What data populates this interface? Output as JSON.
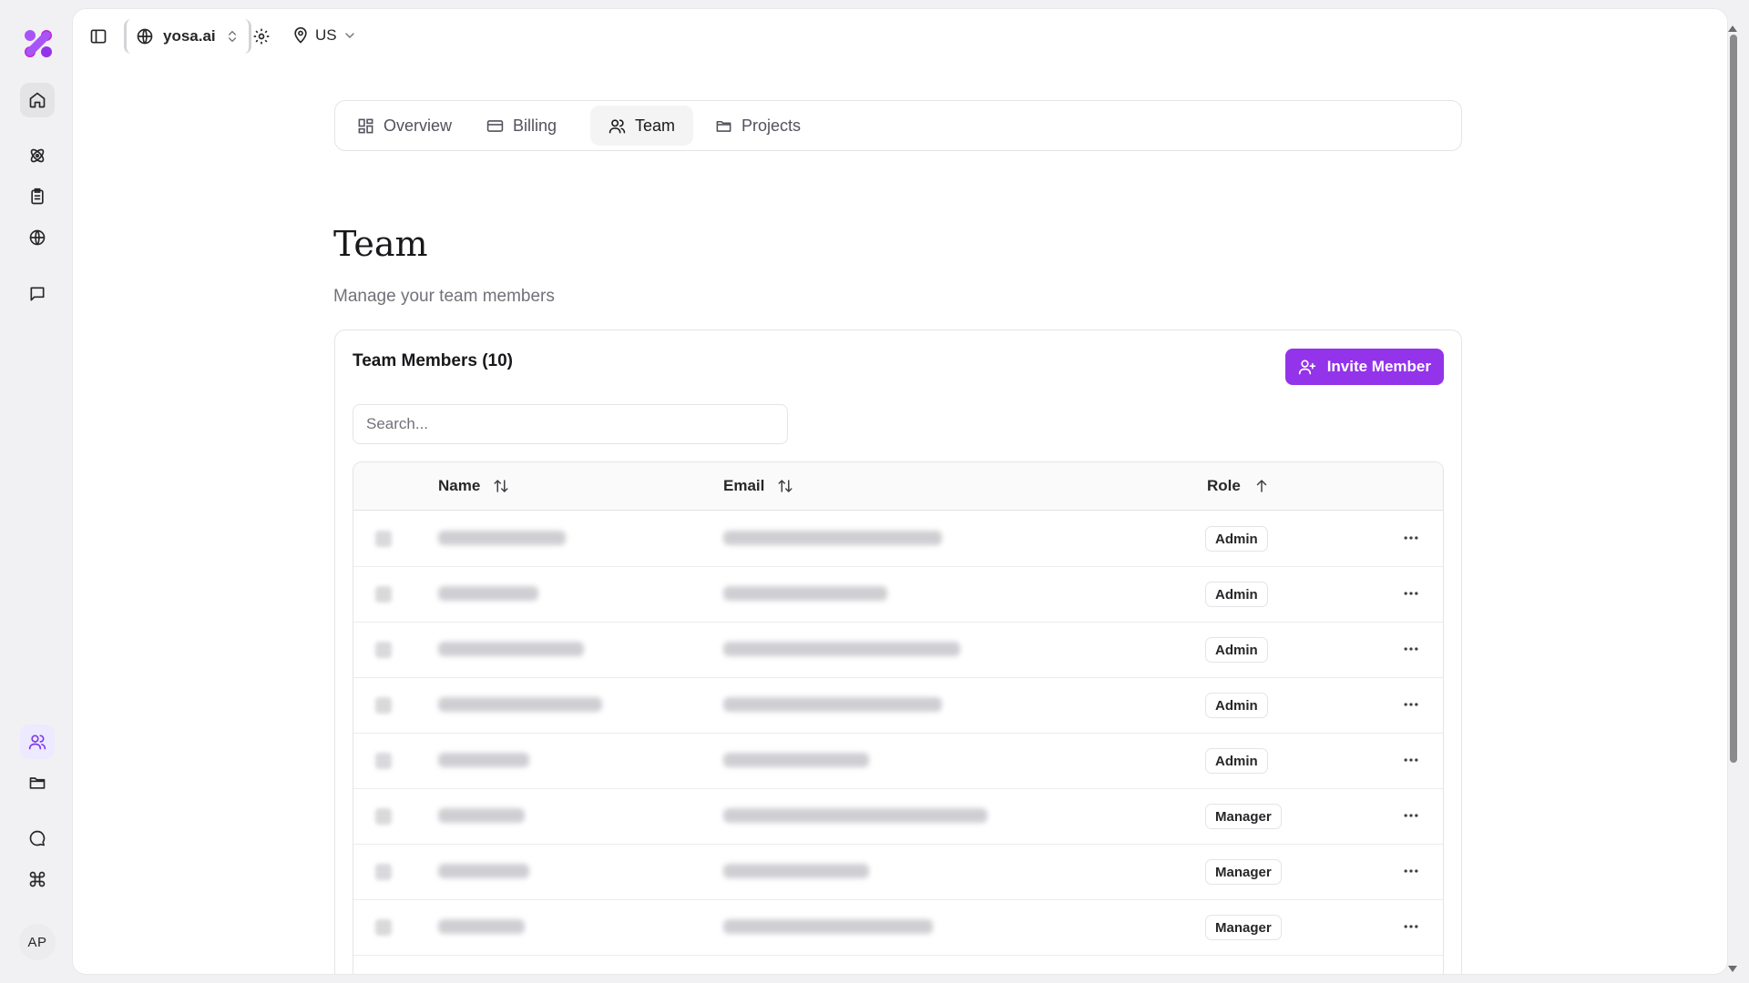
{
  "topbar": {
    "org_name": "yosa.ai",
    "region": "US"
  },
  "sidebar": {
    "avatar_initials": "AP",
    "icons": [
      "home-icon",
      "atom-icon",
      "clipboard-icon",
      "globe-icon",
      "message-square-icon",
      "users-icon",
      "folder-icon",
      "chat-bubble-icon",
      "command-icon"
    ]
  },
  "tabs": [
    {
      "label": "Overview",
      "icon": "layout-grid-icon",
      "active": false
    },
    {
      "label": "Billing",
      "icon": "credit-card-icon",
      "active": false
    },
    {
      "label": "Team",
      "icon": "users-icon",
      "active": true
    },
    {
      "label": "Projects",
      "icon": "folder-icon",
      "active": false
    }
  ],
  "page": {
    "title": "Team",
    "subtitle": "Manage your team members"
  },
  "card": {
    "title": "Team Members (10)",
    "invite_label": "Invite Member",
    "search_placeholder": "Search..."
  },
  "table": {
    "columns": [
      {
        "label": "Name",
        "sort": "none"
      },
      {
        "label": "Email",
        "sort": "none"
      },
      {
        "label": "Role",
        "sort": "ascending"
      }
    ],
    "rows": [
      {
        "role": "Admin"
      },
      {
        "role": "Admin"
      },
      {
        "role": "Admin"
      },
      {
        "role": "Admin"
      },
      {
        "role": "Admin"
      },
      {
        "role": "Manager"
      },
      {
        "role": "Manager"
      },
      {
        "role": "Manager"
      }
    ]
  },
  "colors": {
    "accent": "#9333ea",
    "accent_logo": "#a855f7"
  }
}
